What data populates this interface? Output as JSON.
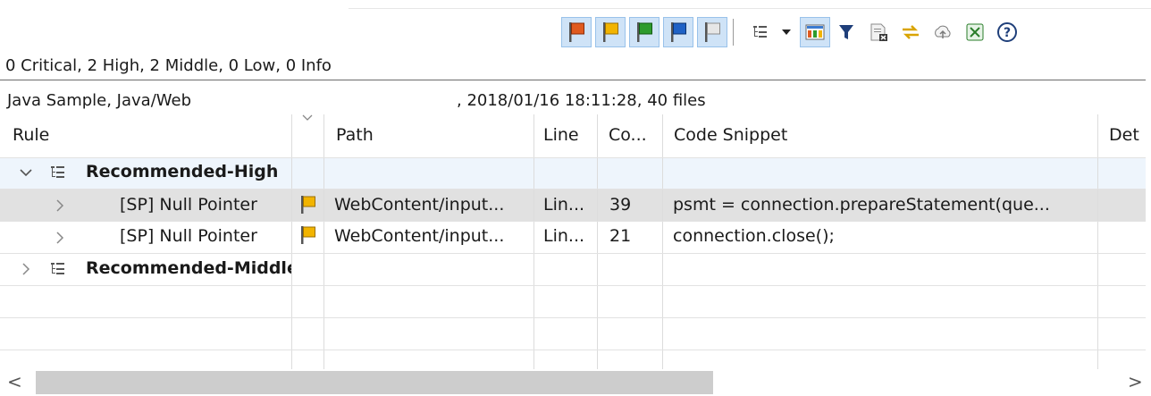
{
  "summary": "0 Critical, 2 High, 2 Middle, 0 Low, 0 Info",
  "project": "Java Sample, Java/Web",
  "meta": ", 2018/01/16 18:11:28, 40 files",
  "toolbar": {
    "flags": [
      {
        "name": "critical-flag-icon",
        "color": "#e05a1f"
      },
      {
        "name": "high-flag-icon",
        "color": "#f2b400"
      },
      {
        "name": "middle-flag-icon",
        "color": "#2e9b2e"
      },
      {
        "name": "low-flag-icon",
        "color": "#1f62c6"
      },
      {
        "name": "info-flag-icon",
        "color": "#c8c8c8"
      }
    ],
    "icons": [
      "tree-view-icon",
      "dropdown-arrow-icon",
      "columns-icon",
      "filter-icon",
      "export-icon",
      "sync-icon",
      "upload-icon",
      "excel-icon",
      "help-icon"
    ]
  },
  "columns": {
    "rule": "Rule",
    "path": "Path",
    "line": "Line",
    "count": "Co...",
    "snippet": "Code Snippet",
    "detail": "Det"
  },
  "rows": [
    {
      "type": "group",
      "expanded": true,
      "label": "Recommended-High"
    },
    {
      "type": "item",
      "rule": "[SP] Null Pointer ",
      "flag_color": "#f2b400",
      "path": "WebContent/input...",
      "line": "Lin...",
      "count": "39",
      "snippet": "psmt = connection.prepareStatement(que...",
      "selected": true
    },
    {
      "type": "item",
      "rule": "[SP] Null Pointer ",
      "flag_color": "#f2b400",
      "path": "WebContent/input...",
      "line": "Lin...",
      "count": "21",
      "snippet": "connection.close();",
      "selected": false
    },
    {
      "type": "group",
      "expanded": false,
      "label": "Recommended-Middle"
    }
  ],
  "scroll": {
    "left": "<",
    "right": ">"
  }
}
